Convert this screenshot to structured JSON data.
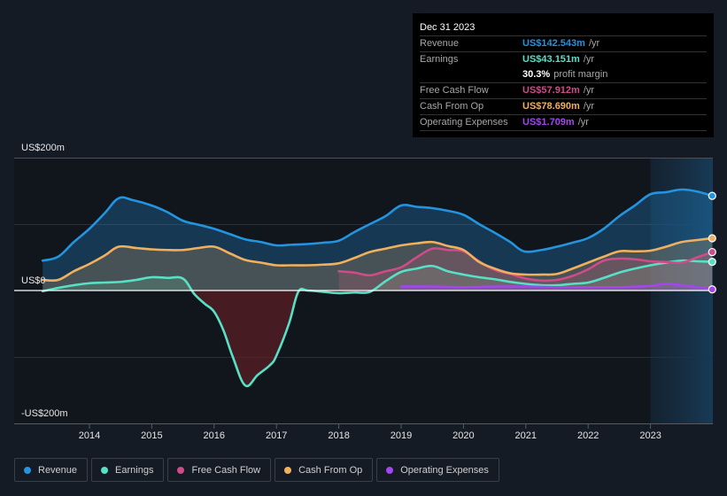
{
  "tooltip": {
    "date": "Dec 31 2023",
    "rows": [
      {
        "label": "Revenue",
        "value": "US$142.543m",
        "unit": "/yr",
        "color": "#2394df"
      },
      {
        "label": "Earnings",
        "value": "US$43.151m",
        "unit": "/yr",
        "color": "#58e0c6"
      },
      {
        "label": "",
        "value": "30.3%",
        "unit": "profit margin",
        "color": "#ffffff"
      },
      {
        "label": "Free Cash Flow",
        "value": "US$57.912m",
        "unit": "/yr",
        "color": "#d04b8a"
      },
      {
        "label": "Cash From Op",
        "value": "US$78.690m",
        "unit": "/yr",
        "color": "#f0b05e"
      },
      {
        "label": "Operating Expenses",
        "value": "US$1.709m",
        "unit": "/yr",
        "color": "#a346f0"
      }
    ]
  },
  "legend": [
    {
      "label": "Revenue",
      "color": "#2394df"
    },
    {
      "label": "Earnings",
      "color": "#58e0c6"
    },
    {
      "label": "Free Cash Flow",
      "color": "#d04b8a"
    },
    {
      "label": "Cash From Op",
      "color": "#f0b05e"
    },
    {
      "label": "Operating Expenses",
      "color": "#a346f0"
    }
  ],
  "chart_data": {
    "type": "area",
    "title": "",
    "xlabel": "",
    "ylabel": "",
    "ylim": [
      -200,
      200
    ],
    "xlim": [
      2013.25,
      2023.99
    ],
    "y_tick_labels": [
      "US$200m",
      "US$0",
      "-US$200m"
    ],
    "x_tick_labels": [
      "2014",
      "2015",
      "2016",
      "2017",
      "2018",
      "2019",
      "2020",
      "2021",
      "2022",
      "2023"
    ],
    "x_ticks": [
      2014,
      2015,
      2016,
      2017,
      2018,
      2019,
      2020,
      2021,
      2022,
      2023
    ],
    "highlight_region": [
      2023.0,
      2023.99
    ],
    "grid": true,
    "series": [
      {
        "name": "Revenue",
        "color": "#2394df",
        "x": [
          2013.25,
          2013.5,
          2013.75,
          2014.0,
          2014.25,
          2014.47,
          2014.7,
          2015.0,
          2015.25,
          2015.5,
          2015.75,
          2016.0,
          2016.25,
          2016.5,
          2016.75,
          2017.0,
          2017.25,
          2017.5,
          2017.75,
          2018.0,
          2018.25,
          2018.5,
          2018.75,
          2019.0,
          2019.25,
          2019.5,
          2019.75,
          2020.0,
          2020.25,
          2020.5,
          2020.75,
          2020.97,
          2021.25,
          2021.5,
          2021.75,
          2022.0,
          2022.25,
          2022.5,
          2022.75,
          2023.0,
          2023.25,
          2023.5,
          2023.75,
          2023.99
        ],
        "y": [
          45,
          51,
          73,
          93,
          117,
          139,
          136,
          128,
          118,
          105,
          99,
          93,
          85,
          77,
          73,
          68,
          69,
          70,
          72,
          75,
          88,
          100,
          112,
          128,
          126,
          124,
          120,
          114,
          100,
          87,
          73,
          59,
          61,
          66,
          72,
          79,
          93,
          112,
          128,
          145,
          148,
          152,
          149,
          142.5
        ]
      },
      {
        "name": "Earnings",
        "color": "#58e0c6",
        "x": [
          2013.25,
          2013.5,
          2013.75,
          2014.0,
          2014.25,
          2014.5,
          2014.75,
          2015.0,
          2015.25,
          2015.5,
          2015.68,
          2015.85,
          2016.0,
          2016.15,
          2016.3,
          2016.5,
          2016.7,
          2016.9,
          2017.0,
          2017.2,
          2017.35,
          2017.5,
          2017.75,
          2018.0,
          2018.25,
          2018.5,
          2018.75,
          2019.0,
          2019.25,
          2019.5,
          2019.75,
          2020.0,
          2020.25,
          2020.5,
          2020.75,
          2021.0,
          2021.25,
          2021.5,
          2021.75,
          2022.0,
          2022.25,
          2022.5,
          2022.75,
          2023.0,
          2023.25,
          2023.5,
          2023.75,
          2023.99
        ],
        "y": [
          -1,
          4,
          8,
          11,
          12,
          13,
          16,
          20,
          19,
          18,
          -5,
          -20,
          -32,
          -60,
          -100,
          -143,
          -127,
          -112,
          -98,
          -50,
          -2,
          0,
          -2,
          -4,
          -3,
          -2,
          14,
          28,
          33,
          37,
          29,
          24,
          20,
          17,
          13,
          10,
          8,
          8,
          10,
          12,
          19,
          27,
          33,
          38,
          42,
          45,
          44,
          43.2
        ]
      },
      {
        "name": "Free Cash Flow",
        "color": "#d04b8a",
        "x": [
          2018.0,
          2018.25,
          2018.5,
          2018.75,
          2019.0,
          2019.25,
          2019.5,
          2019.75,
          2020.0,
          2020.25,
          2020.5,
          2020.75,
          2021.0,
          2021.25,
          2021.5,
          2021.75,
          2022.0,
          2022.25,
          2022.5,
          2022.75,
          2023.0,
          2023.25,
          2023.5,
          2023.75,
          2023.99
        ],
        "y": [
          29,
          27,
          23,
          29,
          35,
          50,
          63,
          61,
          59,
          44,
          31,
          25,
          18,
          15,
          16,
          22,
          32,
          45,
          48,
          47,
          44,
          43,
          42,
          50,
          57.9
        ]
      },
      {
        "name": "Cash From Op",
        "color": "#f0b05e",
        "x": [
          2013.25,
          2013.5,
          2013.75,
          2014.0,
          2014.25,
          2014.47,
          2014.75,
          2015.0,
          2015.25,
          2015.5,
          2015.75,
          2016.0,
          2016.25,
          2016.5,
          2016.75,
          2017.0,
          2017.25,
          2017.5,
          2017.75,
          2018.0,
          2018.25,
          2018.5,
          2018.75,
          2019.0,
          2019.25,
          2019.5,
          2019.75,
          2020.0,
          2020.25,
          2020.5,
          2020.75,
          2021.0,
          2021.25,
          2021.5,
          2021.75,
          2022.0,
          2022.25,
          2022.5,
          2022.75,
          2023.0,
          2023.25,
          2023.5,
          2023.75,
          2023.99
        ],
        "y": [
          16,
          16,
          29,
          40,
          53,
          66,
          64,
          62,
          61,
          61,
          64,
          66,
          56,
          46,
          42,
          38,
          38,
          38,
          39,
          41,
          49,
          58,
          63,
          68,
          71,
          73,
          67,
          61,
          43,
          33,
          26,
          24,
          24,
          25,
          33,
          42,
          51,
          59,
          59,
          60,
          66,
          73,
          76,
          78.7
        ]
      },
      {
        "name": "Operating Expenses",
        "color": "#a346f0",
        "x": [
          2019.0,
          2019.5,
          2020.0,
          2020.5,
          2021.0,
          2021.5,
          2022.0,
          2022.5,
          2023.0,
          2023.25,
          2023.5,
          2023.75,
          2023.99
        ],
        "y": [
          6,
          6,
          5,
          6,
          6,
          5,
          5,
          5,
          7,
          10,
          8,
          5,
          1.7
        ]
      }
    ]
  }
}
